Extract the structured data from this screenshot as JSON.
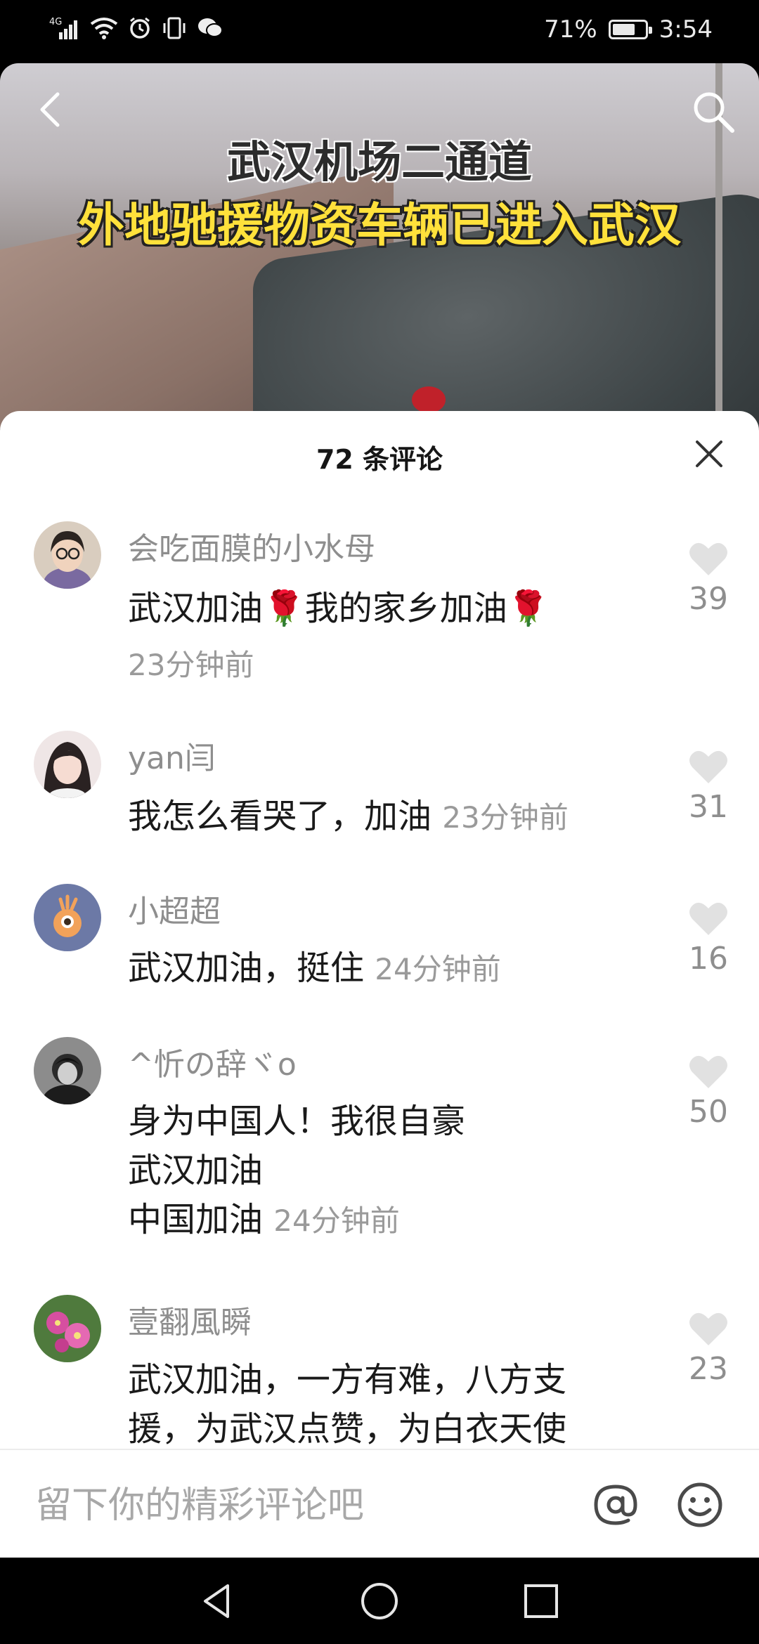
{
  "status_bar": {
    "network_label": "4G",
    "battery_text": "71%",
    "battery_level": 0.71,
    "time": "3:54",
    "icons": [
      "signal-icon",
      "wifi-icon",
      "alarm-icon",
      "vibrate-icon",
      "wechat-icon",
      "battery-icon"
    ]
  },
  "video": {
    "title_line1": "武汉机场二通道",
    "title_line2": "外地驰援物资车辆已进入武汉",
    "title_line2_color": "#ffe13b",
    "back_icon": "back-arrow-icon",
    "search_icon": "search-icon"
  },
  "comments_panel": {
    "count_label": "72 条评论",
    "close_icon": "close-icon",
    "comments": [
      {
        "name": "会吃面膜的小水母",
        "text": "武汉加油🌹我的家乡加油🌹",
        "time": "23分钟前",
        "likes": "39"
      },
      {
        "name": "yan闫",
        "text": "我怎么看哭了，加油",
        "time": "23分钟前",
        "likes": "31"
      },
      {
        "name": "小超超",
        "text": "武汉加油，挺住",
        "time": "24分钟前",
        "likes": "16"
      },
      {
        "name": "^忻の辞ヾo",
        "text_lines": [
          "身为中国人！我很自豪",
          "武汉加油",
          "中国加油"
        ],
        "time": "24分钟前",
        "likes": "50"
      },
      {
        "name": "壹翻風瞬",
        "text_lines": [
          "武汉加油，一方有难，八方支",
          "援，为武汉点赞，为白衣天使"
        ],
        "likes": "23"
      }
    ]
  },
  "input_bar": {
    "placeholder": "留下你的精彩评论吧",
    "at_icon": "at-icon",
    "emoji_icon": "emoji-icon"
  },
  "nav_bar": {
    "icons": [
      "nav-back-icon",
      "nav-home-icon",
      "nav-recents-icon"
    ]
  }
}
